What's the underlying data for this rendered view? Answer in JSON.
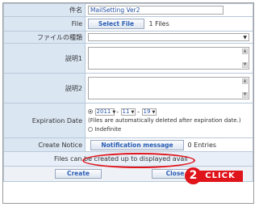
{
  "form": {
    "name_label": "件名",
    "name_value": "MailSetting Ver2",
    "file_label": "File",
    "select_file_button": "Select File",
    "file_count": "1 Files",
    "filetype_label": "ファイルの種類",
    "desc1_label": "説明1",
    "desc2_label": "説明2",
    "expiration_label": "Expiration Date",
    "year": "2011",
    "month": "11",
    "day": "19",
    "sep1": "-",
    "sep2": "-",
    "auto_delete_note": "(Files are automatically deleted after expiration date.)",
    "indefinite_label": "Indefinite",
    "notice_label": "Create Notice",
    "notification_button": "Notification message",
    "entries_text": "0 Entries",
    "footer_note": "Files can be created up to displayed avail",
    "create_button": "Create",
    "close_button": "Close"
  },
  "callout": {
    "step_number": "2",
    "click_label": "CLICK",
    "highlight_color": "#e0141b"
  }
}
